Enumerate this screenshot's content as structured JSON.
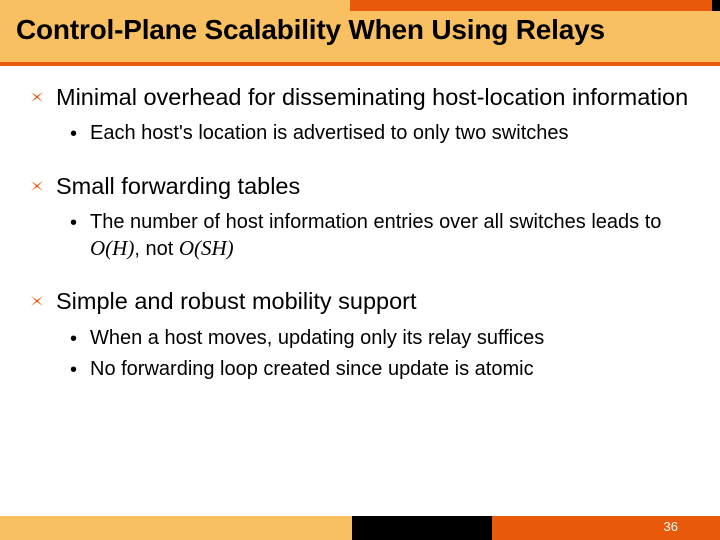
{
  "title": "Control-Plane Scalability When Using Relays",
  "points": {
    "p1": {
      "text": "Minimal overhead for disseminating host-location information",
      "subs": {
        "s1": "Each host's location is advertised to only two switches"
      }
    },
    "p2": {
      "text": "Small forwarding tables",
      "subs": {
        "s1_a": "The number of host information entries over all switches leads to ",
        "s1_m1": "O(H)",
        "s1_b": ", not ",
        "s1_m2": "O(SH)"
      }
    },
    "p3": {
      "text": "Simple and robust mobility support",
      "subs": {
        "s1": "When a host moves, updating only its relay suffices",
        "s2": "No forwarding loop created since update is atomic"
      }
    }
  },
  "page_number": "36"
}
